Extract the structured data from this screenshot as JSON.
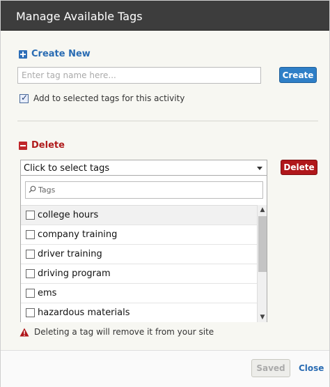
{
  "dialog": {
    "title": "Manage Available Tags"
  },
  "create": {
    "heading": "Create New",
    "input_placeholder": "Enter tag name here...",
    "input_value": "",
    "button_label": "Create",
    "add_to_selected_label": "Add to selected tags for this activity",
    "add_to_selected_checked": true
  },
  "delete": {
    "heading": "Delete",
    "select_label": "Click to select tags",
    "button_label": "Delete",
    "search_placeholder": "Tags",
    "items": [
      {
        "label": "college hours",
        "checked": false
      },
      {
        "label": "company training",
        "checked": false
      },
      {
        "label": "driver training",
        "checked": false
      },
      {
        "label": "driving program",
        "checked": false
      },
      {
        "label": "ems",
        "checked": false
      },
      {
        "label": "hazardous materials",
        "checked": false
      }
    ],
    "warning": "Deleting a tag will remove it from your site"
  },
  "footer": {
    "saved_label": "Saved",
    "close_label": "Close"
  },
  "colors": {
    "title_bar": "#3d3d3d",
    "create_accent": "#2f7fc7",
    "delete_accent": "#b0171b"
  },
  "icons": {
    "create": "plus-square-icon",
    "delete": "minus-square-icon",
    "search": "search-icon",
    "warning": "warning-icon"
  }
}
